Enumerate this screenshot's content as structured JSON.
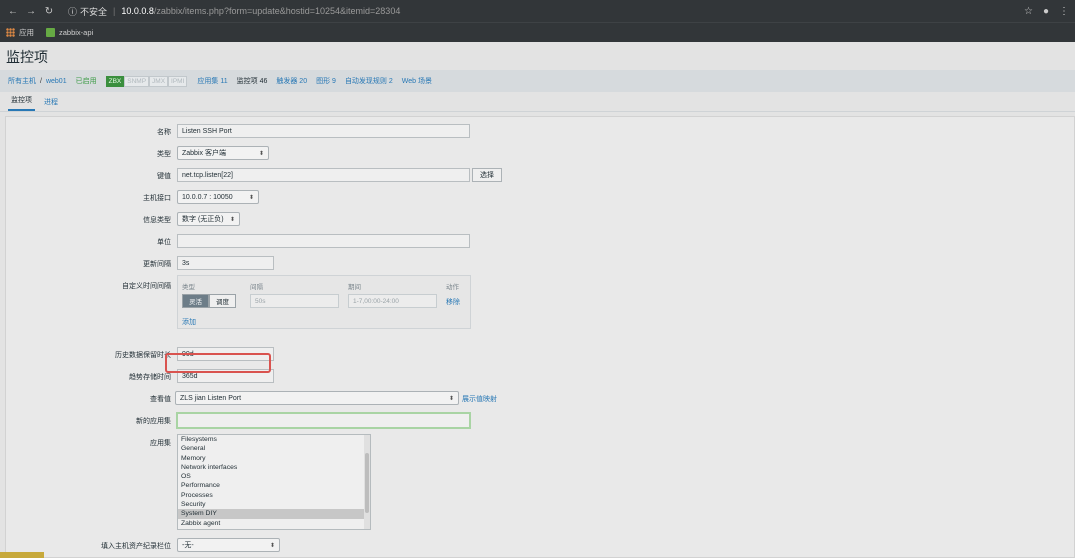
{
  "browser": {
    "url_warning": "不安全",
    "url_host": "10.0.0.8",
    "url_path": "/zabbix/items.php?form=update&hostid=10254&itemid=28304",
    "bookmarks": [
      "应用",
      "zabbix-api"
    ]
  },
  "page": {
    "title": "监控项"
  },
  "breadcrumb": {
    "all_hosts": "所有主机",
    "host": "web01",
    "enabled": "已启用",
    "tags": [
      "ZBX",
      "SNMP",
      "JMX",
      "IPMI"
    ],
    "links": [
      "应用集 11",
      "监控项 46",
      "触发器 20",
      "图形 9",
      "自动发现规则 2",
      "Web 场景"
    ]
  },
  "tabs": [
    "监控项",
    "进程"
  ],
  "form": {
    "name_label": "名称",
    "name_value": "Listen SSH Port",
    "type_label": "类型",
    "type_value": "Zabbix 客户端",
    "key_label": "键值",
    "key_value": "net.tcp.listen[22]",
    "key_button": "选择",
    "iface_label": "主机接口",
    "iface_value": "10.0.0.7 : 10050",
    "info_label": "信息类型",
    "info_value": "数字 (无正负)",
    "unit_label": "单位",
    "unit_value": "",
    "update_label": "更新间隔",
    "update_value": "3s",
    "custom_label": "自定义时间间隔",
    "custom_headers": [
      "类型",
      "间隔",
      "期间",
      "动作"
    ],
    "custom_flexible": "灵活",
    "custom_schedule": "调度",
    "custom_interval_ph": "50s",
    "custom_period_ph": "1-7,00:00-24:00",
    "custom_remove": "移除",
    "custom_add": "添加",
    "history_label": "历史数据保留时长",
    "history_value": "90d",
    "trend_label": "趋势存储时间",
    "trend_value": "365d",
    "valuemap_label": "查看值",
    "valuemap_value": "ZLS jian Listen Port",
    "valuemap_link": "展示值映射",
    "newapp_label": "新的应用集",
    "newapp_value": "",
    "apps_label": "应用集",
    "apps": [
      "Filesystems",
      "General",
      "Memory",
      "Network interfaces",
      "OS",
      "Performance",
      "Processes",
      "Security",
      "System DIY",
      "Zabbix agent"
    ],
    "apps_selected": "System DIY",
    "inventory_label": "填入主机资产纪录栏位",
    "inventory_value": "-无-"
  }
}
